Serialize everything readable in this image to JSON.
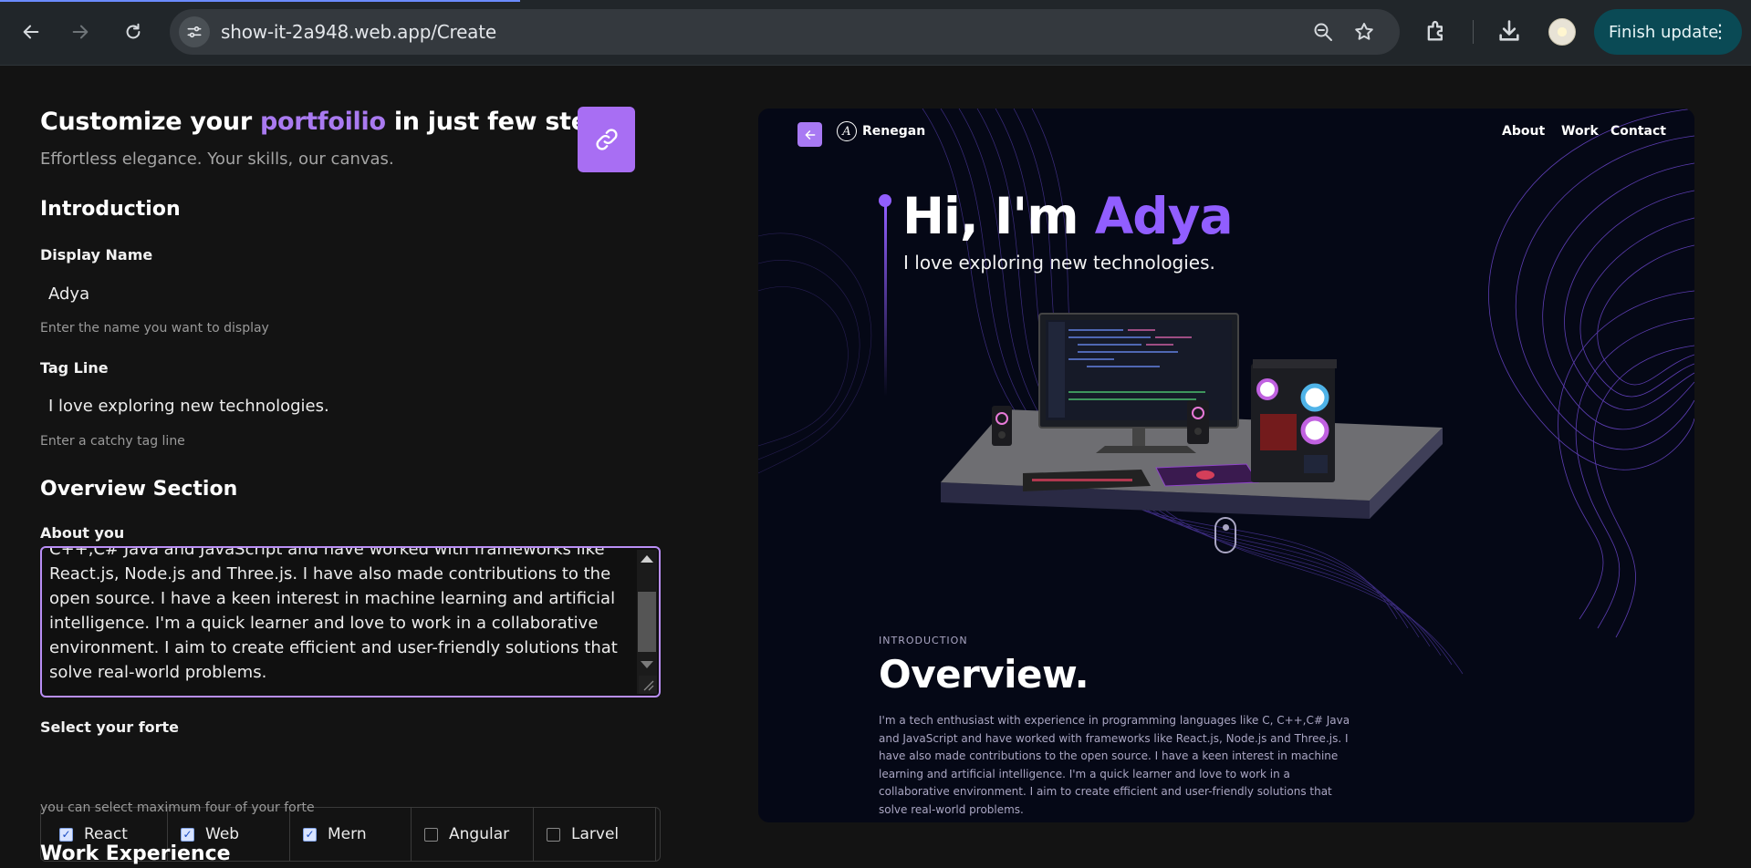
{
  "browser": {
    "url": "show-it-2a948.web.app/Create",
    "update_label": "Finish update"
  },
  "form": {
    "title_prefix": "Customize your",
    "title_accent": "portfoilio",
    "title_suffix": "in just few steps",
    "subtitle": "Effortless elegance. Your skills, our canvas.",
    "introduction_heading": "Introduction",
    "display_name": {
      "label": "Display Name",
      "value": "Adya",
      "help": "Enter the name you want to display"
    },
    "tag_line": {
      "label": "Tag Line",
      "value": "I love exploring new technologies.",
      "help": "Enter a catchy tag line"
    },
    "overview_heading": "Overview Section",
    "about": {
      "label": "About you",
      "value": "C++,C# Java and JavaScript and have worked with frameworks like React.js, Node.js and Three.js. I have also made contributions to the open source. I have a keen interest in machine learning and artificial intelligence. I'm a quick learner and love to work in a collaborative environment. I aim to create efficient and user-friendly solutions that solve real-world problems."
    },
    "forte": {
      "label": "Select your forte",
      "options": [
        {
          "label": "React",
          "checked": true
        },
        {
          "label": "Web",
          "checked": true
        },
        {
          "label": "Mern",
          "checked": true
        },
        {
          "label": "Angular",
          "checked": false
        },
        {
          "label": "Larvel",
          "checked": false
        }
      ],
      "help": "you can select maximum four of your forte"
    },
    "work_heading": "Work Experience"
  },
  "preview": {
    "logo_letter": "A",
    "brand": "Renegan",
    "nav": [
      "About",
      "Work",
      "Contact"
    ],
    "greeting": "Hi, I'm",
    "name": "Adya",
    "tagline": "I love exploring new technologies.",
    "intro_label": "INTRODUCTION",
    "overview_title": "Overview.",
    "overview_text": "I'm a tech enthusiast with experience in programming languages like C, C++,C# Java and JavaScript and have worked with frameworks like React.js, Node.js and Three.js. I have also made contributions to the open source. I have a keen interest in machine learning and artificial intelligence. I'm a quick learner and love to work in a collaborative environment. I aim to create efficient and user-friendly solutions that solve real-world problems."
  },
  "colors": {
    "accent": "#a86ef3",
    "preview_accent": "#915eff",
    "chrome_bg": "#21262a",
    "page_bg": "#131313",
    "preview_bg": "#050816",
    "update_btn": "#0a4a55"
  },
  "icons": [
    "back-arrow-icon",
    "forward-arrow-icon",
    "reload-icon",
    "site-info-icon",
    "zoom-icon",
    "bookmark-star-icon",
    "extensions-icon",
    "download-icon",
    "menu-dots-icon",
    "link-icon"
  ]
}
